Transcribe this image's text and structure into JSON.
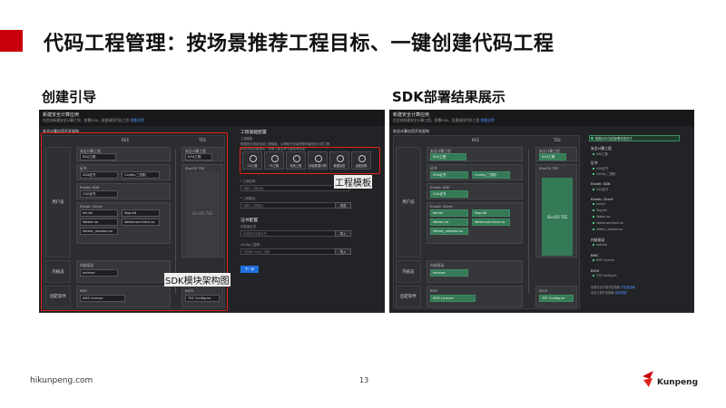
{
  "slide": {
    "title": "代码工程管理：按场景推荐工程目标、一键创建代码工程",
    "left_section_title": "创建引导",
    "right_section_title": "SDK部署结果展示",
    "page_number": "13",
    "footer_url": "hikunpeng.com",
    "brand": "Kunpeng",
    "accent_color": "#c7000b"
  },
  "annotations": {
    "sdk_arch": "SDK模块架构图",
    "template": "工程模板"
  },
  "app": {
    "title": "新建安全计算应用",
    "subtitle": "在此处新建安全计算工程，部署SDK，组建调用代码工程 ",
    "subtitle_link": "查看说明",
    "sdk_arch_title": "安全计算应用开发架构",
    "col_ree": "REE",
    "col_tee": "TEE",
    "row_user": "用户态",
    "row_kernel": "内核态",
    "row_firmware": "固定软件",
    "cards": {
      "ree_sdk_label": "安全计算工程",
      "ree_sdk_chip": "KSA工程",
      "cert_label": "证书",
      "cert_chip1": "SSA证书",
      "cert_chip2": "Config-二进制",
      "elastic_label": "Elastic SDK",
      "elastic_chip": "CSA证书",
      "client_label": "Elastic Client",
      "client_chips": [
        "kernel",
        "lfsguild",
        "libteec.so",
        "libteecxorcheck.so",
        "libteec_adaptor.so"
      ],
      "tee_sdk_label": "安全计算工程",
      "tee_sdk_chip": "KSA工程",
      "tee_os_label": "iSecOS TEE",
      "tee_os_text": "iSecOS TEE",
      "kernel_label": "内核驱动",
      "kernel_chip": "tzdriver",
      "bmc_label": "BMC",
      "bmc_chip": "KMS License",
      "bios_label": "BIOS",
      "bios_chip": "TEE Configure"
    },
    "right_panel": {
      "title": "工程基础配置",
      "subtitle": "工程模板",
      "hint1": "根据安全场景选择工程模板，以帮助开发者快速构建安全计算工程",
      "hint2": "选择对应的模板后，配置工程名称与路径等信息",
      "templates": [
        "CA工程",
        "TA工程",
        "双向工程",
        "机密数据计算",
        "数据加密",
        "远程证明"
      ],
      "name_label": "* 工程名称",
      "name_placeholder": "请输入工程名称",
      "path_label": "* 工程路径",
      "path_placeholder": "请输入工程路径",
      "path_button": "浏览",
      "cert_cfg_title": "证书配置",
      "cert_label": "开发者证书",
      "cert_placeholder": "请选择开发者证书",
      "cert_button": "导入",
      "config_label": "Config二进制",
      "config_placeholder": "请选择Config二进制",
      "config_button": "导入",
      "next_button": "下一步"
    },
    "results": {
      "banner": "根据SDK当前部署状态如下",
      "secure_sdk": "安全计算工程",
      "secure_items": [
        "KSA工程"
      ],
      "cert": "证书",
      "cert_items": [
        "SSA证书",
        "Config-二进制"
      ],
      "elastic_sdk": "Elastic SDK",
      "elastic_items": [
        "CSA证书"
      ],
      "client": "Elastic Client",
      "client_items": [
        "kernel",
        "lfsguild",
        "libteec.so",
        "libteecxorcheck.so",
        "libteec_adaptor.so"
      ],
      "kernel": "内核驱动",
      "kernel_items": [
        "tzdriver"
      ],
      "bmc": "BMC",
      "bmc_items": [
        "KMS License"
      ],
      "bios": "BIOS",
      "bios_items": [
        "TEE Configure"
      ],
      "link1": "查看安全计算开发指南 ",
      "link1_a": "开发者指南",
      "link2": "安全计算开发指南 ",
      "link2_a": "查看详细"
    }
  }
}
